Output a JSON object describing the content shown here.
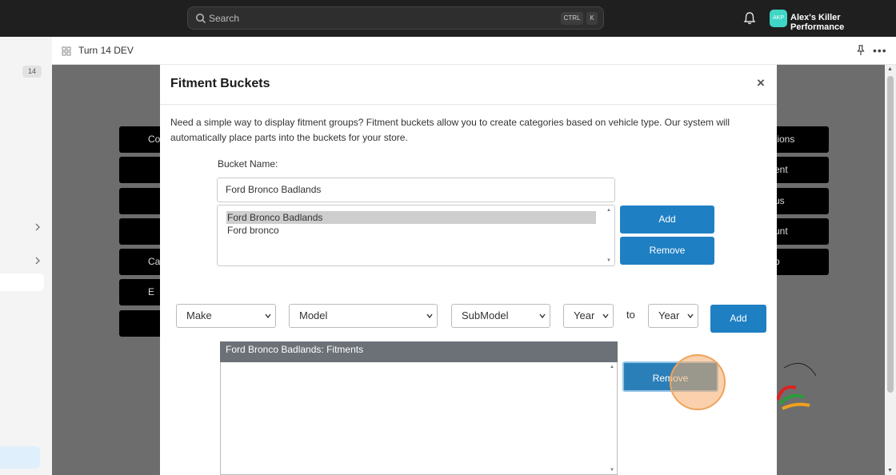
{
  "topbar": {
    "search_placeholder": "Search",
    "shortcut_ctrl": "CTRL",
    "shortcut_key": "K",
    "avatar_initials": "AKP",
    "org_name": "Alex's Killer Performance"
  },
  "sidebar": {
    "badge": "14"
  },
  "page": {
    "title": "Turn 14 DEV"
  },
  "background_buttons": {
    "left": [
      "Co",
      "",
      "",
      "",
      "Ca",
      "E",
      ""
    ],
    "right": [
      "tions",
      "ent",
      "us",
      "unt",
      "p"
    ]
  },
  "modal": {
    "title": "Fitment Buckets",
    "close": "×",
    "description": "Need a simple way to display fitment groups? Fitment buckets allow you to create categories based on vehicle type. Our system will automatically place parts into the buckets for your store.",
    "bucket_name_label": "Bucket Name:",
    "bucket_name_value": "Ford Bronco Badlands",
    "buckets": [
      {
        "label": "Ford Bronco Badlands",
        "selected": true
      },
      {
        "label": "Ford bronco",
        "selected": false
      }
    ],
    "add_bucket_label": "Add",
    "remove_bucket_label": "Remove",
    "filters": {
      "make": "Make",
      "model": "Model",
      "submodel": "SubModel",
      "year_from": "Year",
      "to_label": "to",
      "year_to": "Year",
      "add_label": "Add"
    },
    "fitments_header": "Ford Bronco Badlands: Fitments",
    "remove_fitment_label": "Remove"
  },
  "colors": {
    "primary_button": "#1f7fc3",
    "topbar_bg": "#1f1f1f",
    "avatar_bg": "#3fd6c6",
    "click_highlight": "#f0a35b"
  }
}
